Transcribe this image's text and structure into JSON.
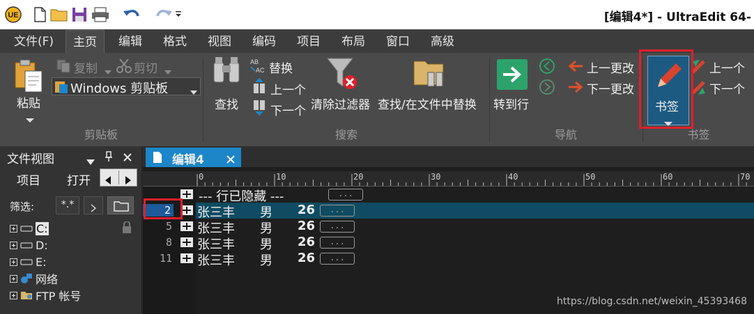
{
  "window": {
    "title": "[编辑4*] - UltraEdit 64-"
  },
  "quick_access": {
    "icons": [
      "ultraedit-logo-icon",
      "new-file-icon",
      "open-folder-icon",
      "save-icon",
      "print-icon",
      "undo-icon",
      "redo-icon",
      "dropdown-icon"
    ]
  },
  "menu": {
    "items": [
      "文件(F)",
      "主页",
      "编辑",
      "格式",
      "视图",
      "编码",
      "项目",
      "布局",
      "窗口",
      "高级"
    ],
    "active_index": 1
  },
  "ribbon": {
    "clipboard": {
      "group_label": "剪贴板",
      "paste": "粘贴",
      "copy": "复制",
      "cut": "剪切",
      "clipboard_select": "Windows 剪贴板"
    },
    "search": {
      "group_label": "搜索",
      "find": "查找",
      "replace": "替换",
      "prev": "上一个",
      "next": "下一个",
      "clear_filter": "清除过滤器",
      "find_in_files": "查找/在文件中替换"
    },
    "navigation": {
      "group_label": "导航",
      "goto_line": "转到行",
      "prev_change": "上一更改",
      "next_change": "下一更改"
    },
    "bookmarks": {
      "group_label": "书签",
      "bookmark": "书签",
      "prev": "上一个",
      "next": "下一个"
    }
  },
  "file_view": {
    "title": "文件视图",
    "tabs": [
      "项目",
      "打开"
    ],
    "filter_label": "筛选:",
    "filter_value": "*.*",
    "tree": [
      {
        "label": "C:",
        "icon": "drive-icon"
      },
      {
        "label": "D:",
        "icon": "drive-icon"
      },
      {
        "label": "E:",
        "icon": "drive-icon"
      },
      {
        "label": "网络",
        "icon": "network-icon"
      },
      {
        "label": "FTP 帐号",
        "icon": "ftp-icon"
      }
    ]
  },
  "editor": {
    "tab_label": "编辑4",
    "ruler_ticks": [
      "0",
      "10",
      "20",
      "30",
      "40",
      "50",
      "60",
      "70"
    ],
    "hidden_line_text": "--- 行已隐藏 ---",
    "ellipsis": "...",
    "lines": [
      {
        "num": "2",
        "name": "张三丰",
        "gender": "男",
        "age": "26",
        "highlight": true
      },
      {
        "num": "5",
        "name": "张三丰",
        "gender": "男",
        "age": "26",
        "highlight": false
      },
      {
        "num": "8",
        "name": "张三丰",
        "gender": "男",
        "age": "26",
        "highlight": false
      },
      {
        "num": "11",
        "name": "张三丰",
        "gender": "男",
        "age": "26",
        "highlight": false
      }
    ]
  },
  "watermark": "https://blog.csdn.net/weixin_45393468",
  "colors": {
    "accent": "#1c86c9",
    "highlight_line": "#0f4b62",
    "annotation_red": "#e0202a",
    "bookmark_red": "#d9432f"
  }
}
